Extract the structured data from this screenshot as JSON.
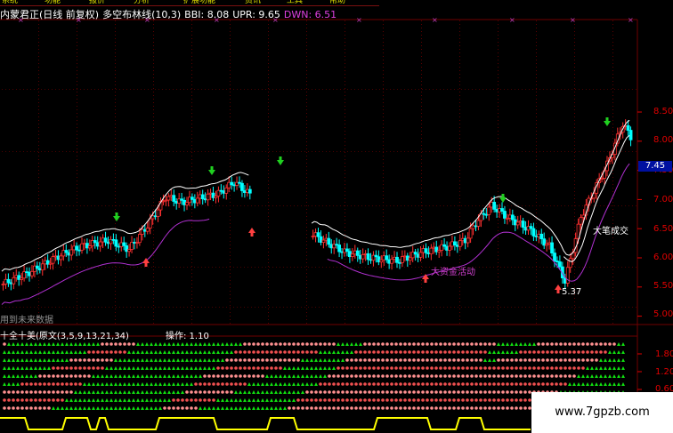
{
  "menu_items": [
    "系统",
    "功能",
    "报价",
    "分析",
    "扩展功能",
    "资讯",
    "工具",
    "帮助"
  ],
  "header": {
    "title": "内蒙君正(日线 前复权)",
    "indicator": "多空布林线(10,3)",
    "bbi": "BBI: 8.08",
    "upr": "UPR: 9.65",
    "dwn": "DWN: 6.51"
  },
  "price_axis": {
    "ticks": [
      "8.50",
      "8.00",
      "7.50",
      "7.00",
      "6.50",
      "6.00",
      "5.50",
      "5.00"
    ],
    "current_price": "7.45"
  },
  "annotations": {
    "big_deal": "大笔成交",
    "capital_active": "大资金活动",
    "low_price": "5.37",
    "future_data": "用到未来数据"
  },
  "lower_indicator": {
    "title": "十全十美(原文(3,5,9,13,21,34)",
    "operation": "操作: 1.10",
    "ticks": [
      "1.80",
      "1.20",
      "0.60"
    ]
  },
  "watermark": "www.7gpzb.com",
  "colors": {
    "up": "#ff3030",
    "down": "#00ffff",
    "up_candle_fill": "#000000",
    "ma_white": "#ffffff",
    "ma_purple": "#b030d0",
    "signal_green": "#20d020",
    "signal_red": "#ff4040",
    "dot_green": "#10e010",
    "dot_red": "#f05050",
    "dot_pink": "#ff9090",
    "step_line": "#ffff00",
    "grid": "#700000",
    "axis_text": "#e00000"
  }
}
